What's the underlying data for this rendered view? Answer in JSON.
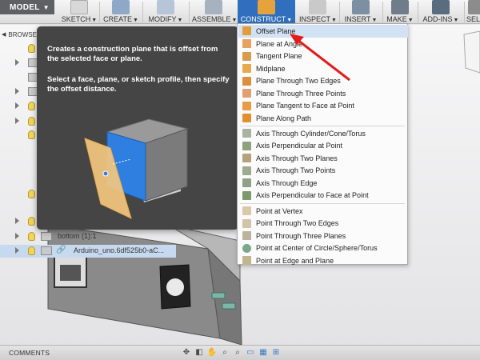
{
  "toolbar": {
    "model_label": "MODEL",
    "groups": [
      {
        "label": "SKETCH"
      },
      {
        "label": "CREATE"
      },
      {
        "label": "MODIFY"
      },
      {
        "label": "ASSEMBLE"
      },
      {
        "label": "CONSTRUCT"
      },
      {
        "label": "INSPECT"
      },
      {
        "label": "INSERT"
      },
      {
        "label": "MAKE"
      },
      {
        "label": "ADD-INS"
      },
      {
        "label": "SEL"
      }
    ],
    "active_group": "CONSTRUCT",
    "accent_color": "#2f6fbd"
  },
  "browser": {
    "title": "BROWSER",
    "rows": [
      {
        "label": "bottom (1):1"
      },
      {
        "label": "Arduino_uno.6df525b0-aC..."
      }
    ]
  },
  "tooltip": {
    "line1": "Creates a construction plane that is offset from the selected face or plane.",
    "line2": "Select a face, plane, or sketch profile, then specify the offset distance."
  },
  "construct_menu": {
    "close_label": "×",
    "items": [
      {
        "label": "Offset Plane",
        "icon": "offset-plane-icon",
        "highlighted": true
      },
      {
        "label": "Plane at Angle",
        "icon": "plane-at-angle-icon"
      },
      {
        "label": "Tangent Plane",
        "icon": "tangent-plane-icon"
      },
      {
        "label": "Midplane",
        "icon": "midplane-icon"
      },
      {
        "label": "Plane Through Two Edges",
        "icon": "plane-two-edges-icon"
      },
      {
        "label": "Plane Through Three Points",
        "icon": "plane-three-points-icon"
      },
      {
        "label": "Plane Tangent to Face at Point",
        "icon": "plane-tangent-face-icon"
      },
      {
        "label": "Plane Along Path",
        "icon": "plane-along-path-icon"
      },
      {
        "label": "Axis Through Cylinder/Cone/Torus",
        "icon": "axis-cylinder-icon"
      },
      {
        "label": "Axis Perpendicular at Point",
        "icon": "axis-perp-point-icon"
      },
      {
        "label": "Axis Through Two Planes",
        "icon": "axis-two-planes-icon"
      },
      {
        "label": "Axis Through Two Points",
        "icon": "axis-two-points-icon"
      },
      {
        "label": "Axis Through Edge",
        "icon": "axis-edge-icon"
      },
      {
        "label": "Axis Perpendicular to Face at Point",
        "icon": "axis-perp-face-icon"
      },
      {
        "label": "Point at Vertex",
        "icon": "point-vertex-icon"
      },
      {
        "label": "Point Through Two Edges",
        "icon": "point-two-edges-icon"
      },
      {
        "label": "Point Through Three Planes",
        "icon": "point-three-planes-icon"
      },
      {
        "label": "Point at Center of Circle/Sphere/Torus",
        "icon": "point-center-icon"
      },
      {
        "label": "Point at Edge and Plane",
        "icon": "point-edge-plane-icon"
      }
    ]
  },
  "bottom": {
    "comments_label": "COMMENTS"
  }
}
